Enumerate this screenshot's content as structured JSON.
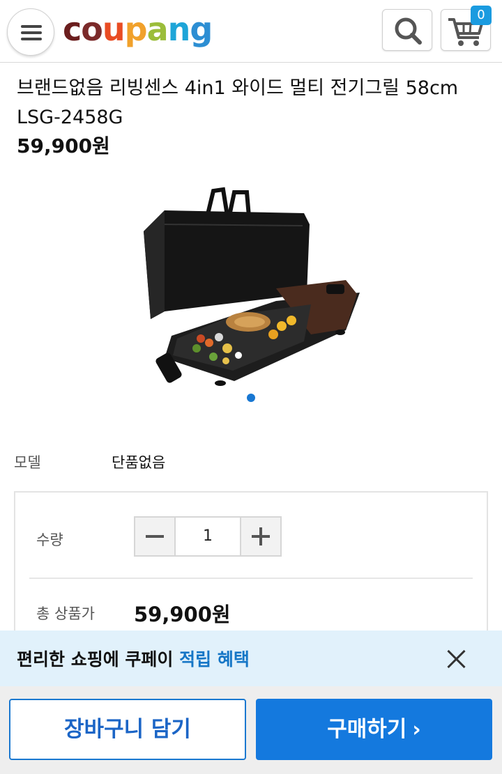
{
  "header": {
    "logo_letters": [
      "c",
      "o",
      "u",
      "p",
      "a",
      "n",
      "g"
    ],
    "cart_count": "0"
  },
  "product": {
    "title": "브랜드없음 리빙센스 4in1 와이드 멀티 전기그릴 58cm LSG-2458G",
    "price": "59,900원"
  },
  "option": {
    "label": "모델",
    "value": "단품없음"
  },
  "purchase": {
    "qty_label": "수량",
    "qty_value": "1",
    "total_label": "총 상품가",
    "total_value": "59,900원"
  },
  "promo": {
    "text_plain": "편리한 쇼핑에 쿠페이 ",
    "text_highlight": "적립 혜택"
  },
  "actions": {
    "cart_button": "장바구니 담기",
    "buy_button": "구매하기",
    "buy_chevron": "›"
  },
  "colors": {
    "accent": "#1479de",
    "badge": "#1a9be0",
    "promo_bg": "#e1f1fb"
  }
}
